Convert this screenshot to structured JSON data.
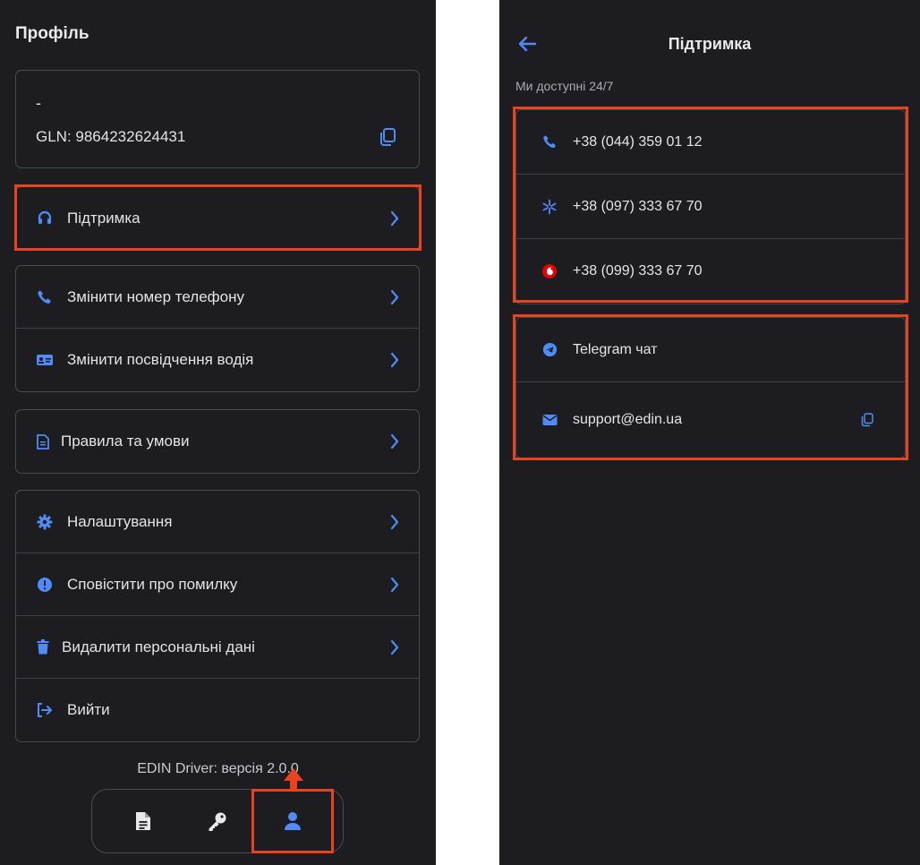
{
  "profile_screen": {
    "title": "Профіль",
    "profile_card": {
      "name": "-",
      "gln": "GLN: 9864232624431"
    },
    "support_item": {
      "label": "Підтримка"
    },
    "account_items": [
      {
        "label": "Змінити номер телефону",
        "icon": "phone-icon"
      },
      {
        "label": "Змінити посвідчення водія",
        "icon": "id-card-icon"
      }
    ],
    "legal_items": [
      {
        "label": "Правила та умови",
        "icon": "document-icon"
      }
    ],
    "settings_items": [
      {
        "label": "Налаштування",
        "icon": "gear-icon"
      },
      {
        "label": "Сповістити про помилку",
        "icon": "alert-icon"
      },
      {
        "label": "Видалити персональні дані",
        "icon": "trash-icon"
      },
      {
        "label": "Вийти",
        "icon": "logout-icon"
      }
    ],
    "version": "EDIN Driver: версія 2.0.0",
    "bottom_nav": [
      {
        "name": "documents",
        "icon": "document-icon"
      },
      {
        "name": "keys",
        "icon": "key-icon"
      },
      {
        "name": "profile",
        "icon": "user-icon",
        "active": true
      }
    ]
  },
  "support_screen": {
    "title": "Підтримка",
    "availability": "Ми доступні 24/7",
    "phones": [
      {
        "label": "+38 (044) 359 01 12",
        "icon": "phone-icon"
      },
      {
        "label": "+38 (097) 333 67 70",
        "icon": "kyivstar-icon"
      },
      {
        "label": "+38 (099) 333 67 70",
        "icon": "vodafone-icon"
      }
    ],
    "contacts": [
      {
        "label": "Telegram чат",
        "icon": "telegram-icon"
      },
      {
        "label": "support@edin.ua",
        "icon": "mail-icon",
        "copyable": true
      }
    ]
  },
  "colors": {
    "background": "#1d1d21",
    "accent": "#4f8cf7",
    "highlight": "#e8431f",
    "vodafone": "#e60000"
  }
}
